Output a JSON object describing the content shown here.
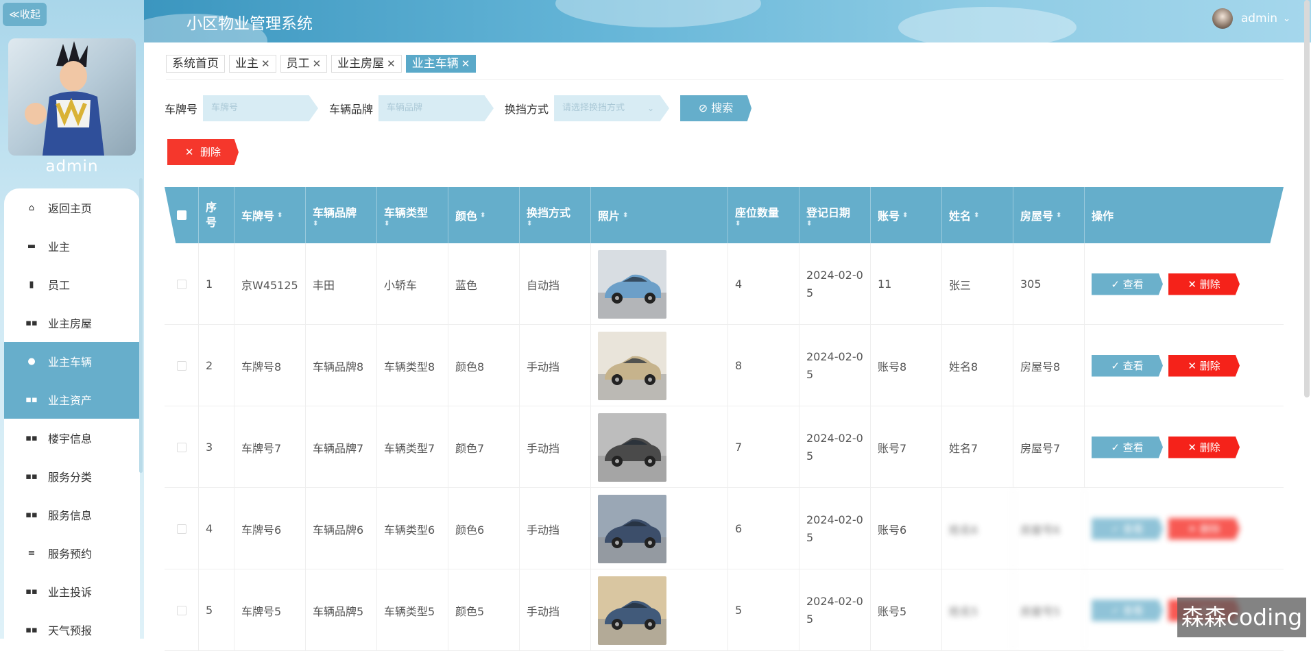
{
  "sidebar": {
    "collapse_label": "≪收起",
    "username": "admin",
    "items": [
      {
        "label": "返回主页",
        "icon": "home-icon"
      },
      {
        "label": "业主",
        "icon": "briefcase-icon"
      },
      {
        "label": "员工",
        "icon": "clipboard-icon"
      },
      {
        "label": "业主房屋",
        "icon": "grid-icon"
      },
      {
        "label": "业主车辆",
        "icon": "bulb-icon"
      },
      {
        "label": "业主资产",
        "icon": "grid-icon"
      },
      {
        "label": "楼宇信息",
        "icon": "grid-icon"
      },
      {
        "label": "服务分类",
        "icon": "grid-icon"
      },
      {
        "label": "服务信息",
        "icon": "grid-icon"
      },
      {
        "label": "服务预约",
        "icon": "list-icon"
      },
      {
        "label": "业主投诉",
        "icon": "grid-icon"
      },
      {
        "label": "天气预报",
        "icon": "grid-icon"
      }
    ]
  },
  "header": {
    "title": "小区物业管理系统",
    "user": "admin"
  },
  "tabs": [
    {
      "label": "系统首页"
    },
    {
      "label": "业主"
    },
    {
      "label": "员工"
    },
    {
      "label": "业主房屋"
    },
    {
      "label": "业主车辆"
    }
  ],
  "search": {
    "plate_label": "车牌号",
    "plate_placeholder": "车牌号",
    "brand_label": "车辆品牌",
    "brand_placeholder": "车辆品牌",
    "gear_label": "换挡方式",
    "gear_placeholder": "请选择换挡方式",
    "search_label": "搜索"
  },
  "toolbar": {
    "delete_label": "删除"
  },
  "table": {
    "headers": [
      "序号",
      "车牌号",
      "车辆品牌",
      "车辆类型",
      "颜色",
      "换挡方式",
      "照片",
      "座位数量",
      "登记日期",
      "账号",
      "姓名",
      "房屋号",
      "操作"
    ],
    "view_label": "查看",
    "delete_label": "删除",
    "rows": [
      {
        "no": "1",
        "plate": "京W45125",
        "brand": "丰田",
        "type": "小轿车",
        "color": "蓝色",
        "gear": "自动挡",
        "seats": "4",
        "date": "2024-02-05",
        "account": "11",
        "name": "张三",
        "house": "305"
      },
      {
        "no": "2",
        "plate": "车牌号8",
        "brand": "车辆品牌8",
        "type": "车辆类型8",
        "color": "颜色8",
        "gear": "手动挡",
        "seats": "8",
        "date": "2024-02-05",
        "account": "账号8",
        "name": "姓名8",
        "house": "房屋号8"
      },
      {
        "no": "3",
        "plate": "车牌号7",
        "brand": "车辆品牌7",
        "type": "车辆类型7",
        "color": "颜色7",
        "gear": "手动挡",
        "seats": "7",
        "date": "2024-02-05",
        "account": "账号7",
        "name": "姓名7",
        "house": "房屋号7"
      },
      {
        "no": "4",
        "plate": "车牌号6",
        "brand": "车辆品牌6",
        "type": "车辆类型6",
        "color": "颜色6",
        "gear": "手动挡",
        "seats": "6",
        "date": "2024-02-05",
        "account": "账号6",
        "name": "姓名6",
        "house": "房屋号6"
      },
      {
        "no": "5",
        "plate": "车牌号5",
        "brand": "车辆品牌5",
        "type": "车辆类型5",
        "color": "颜色5",
        "gear": "手动挡",
        "seats": "5",
        "date": "2024-02-05",
        "account": "账号5",
        "name": "姓名5",
        "house": "房屋号5"
      }
    ]
  },
  "watermark": "森森coding",
  "colors": {
    "primary": "#65aecb",
    "danger": "#f5372c",
    "header": "#3b96bf"
  }
}
